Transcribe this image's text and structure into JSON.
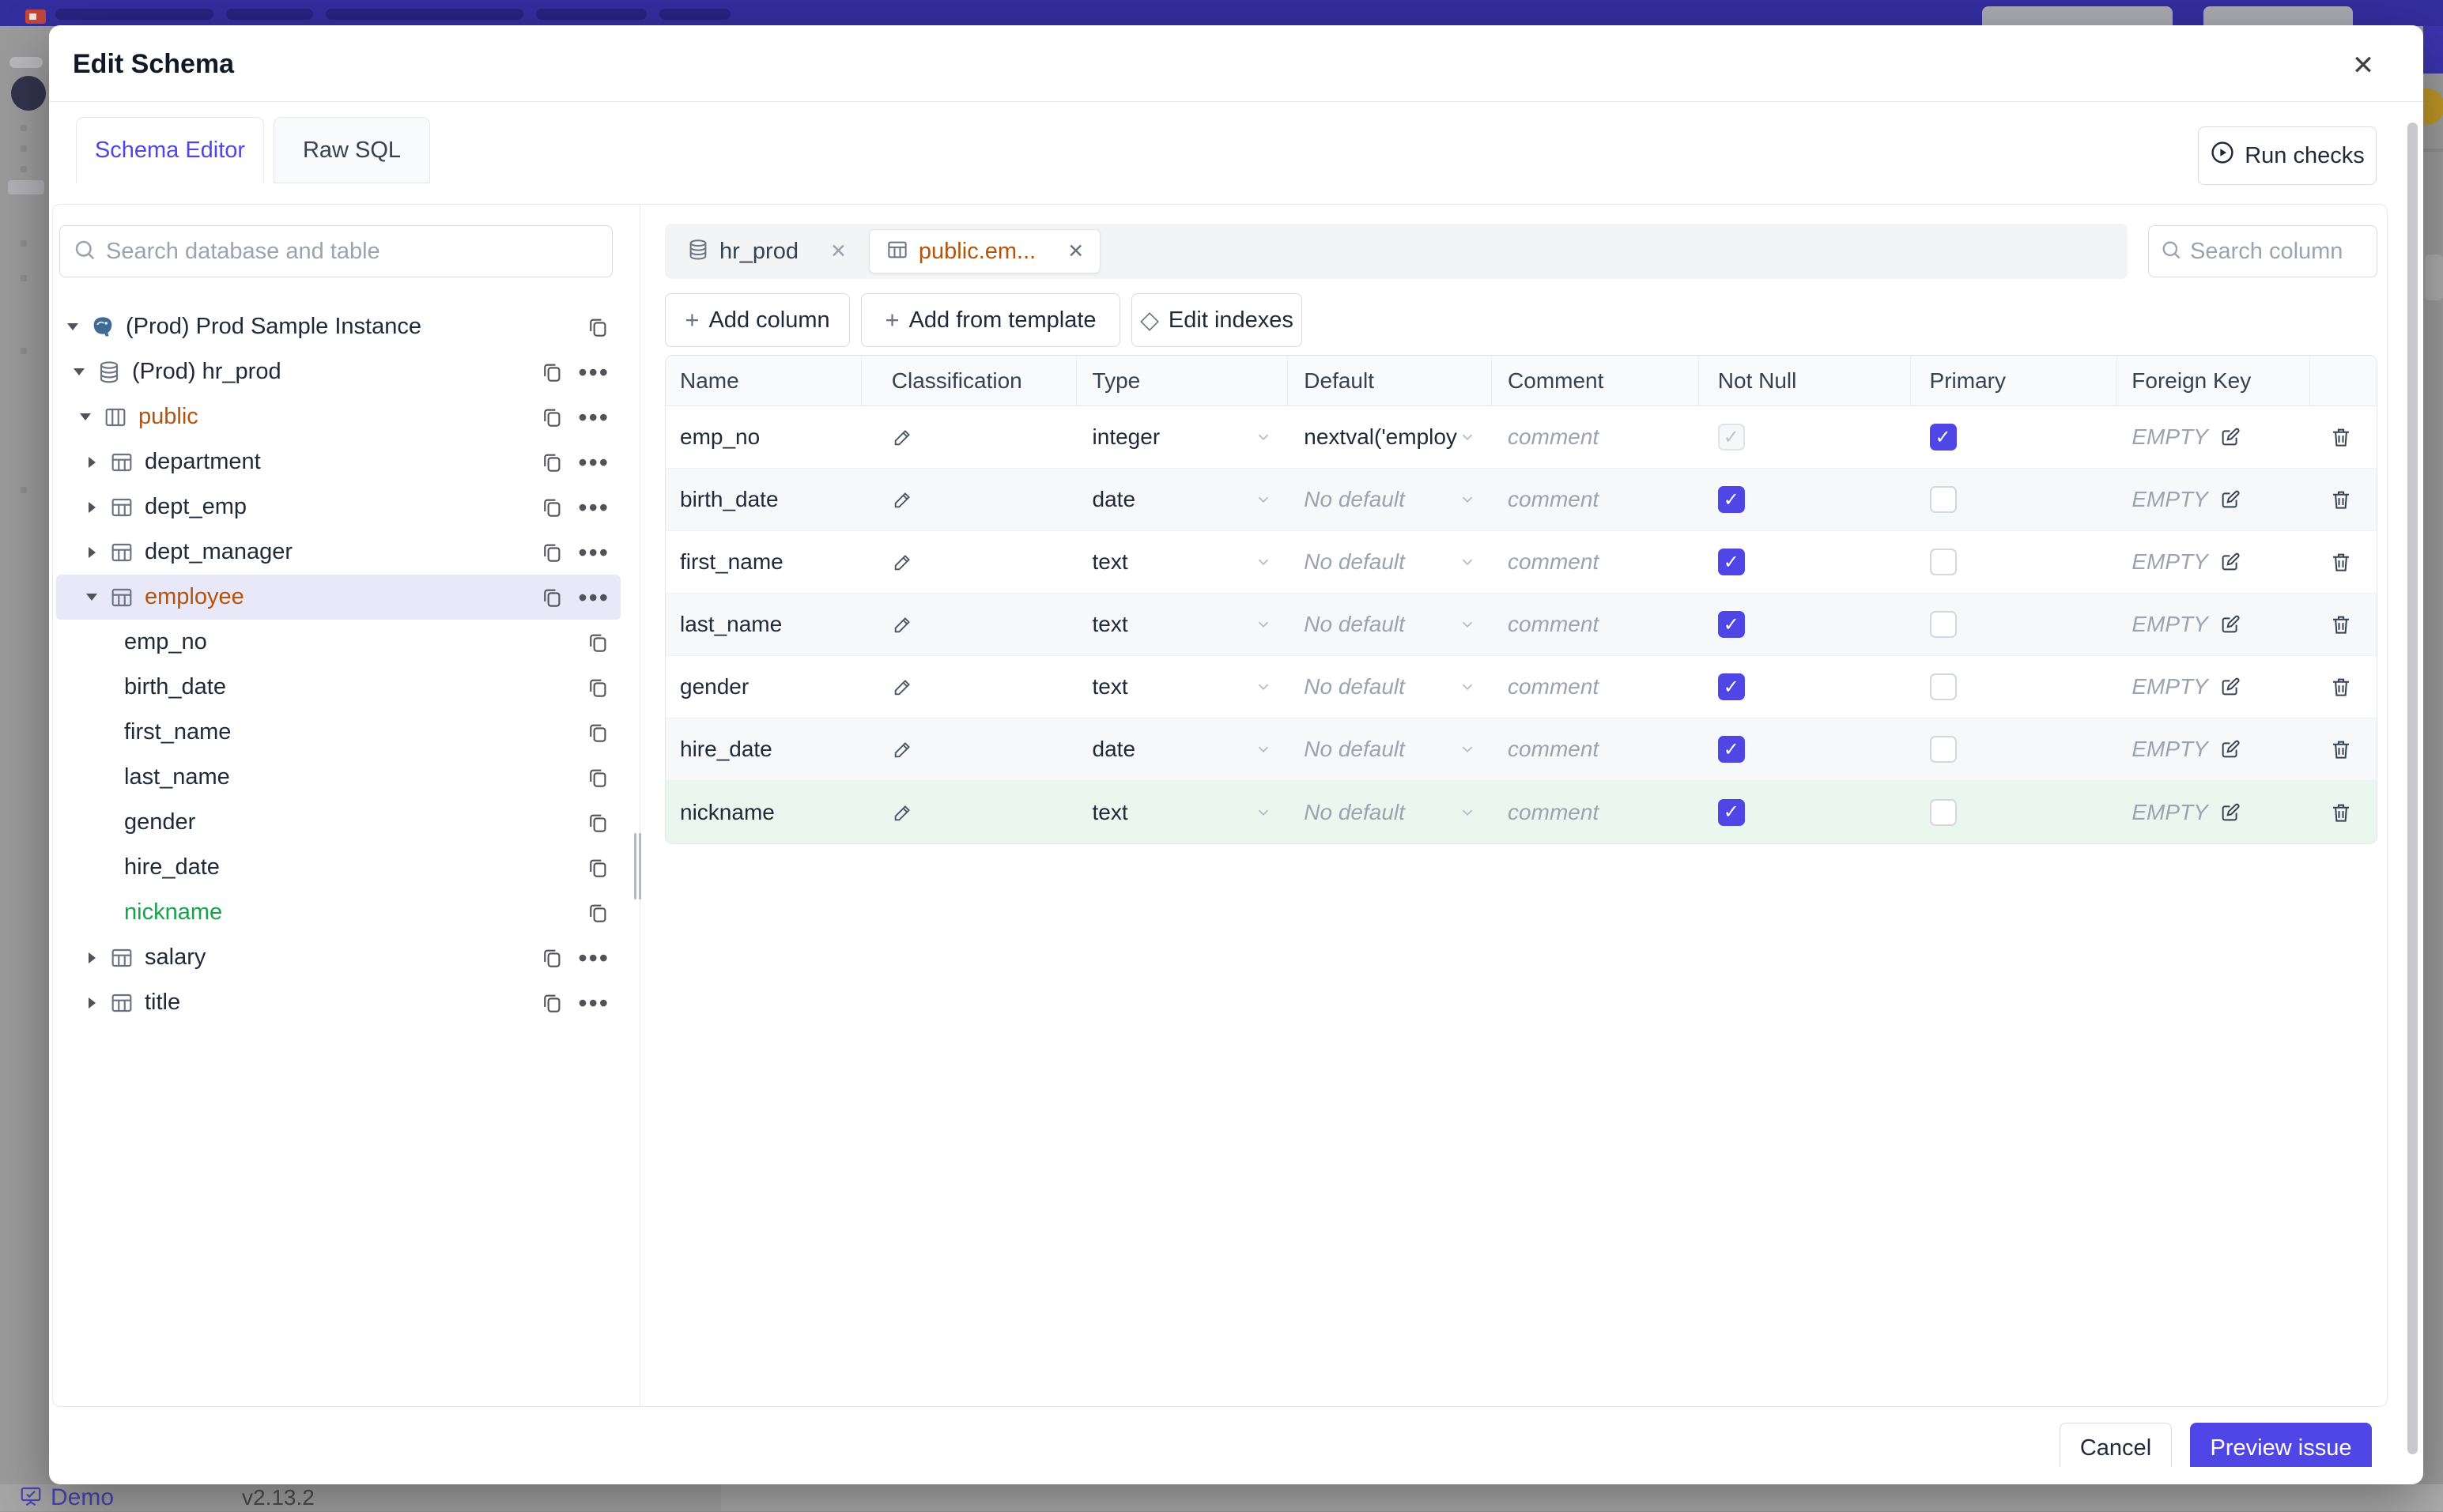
{
  "colors": {
    "accent": "#4f46e5",
    "modified_orange": "#b45309",
    "added_green": "#16a34a",
    "navbar": "#332e9e"
  },
  "chrome": {
    "demo_label": "Demo",
    "version": "v2.13.2"
  },
  "modal": {
    "title": "Edit Schema",
    "close_icon": "✕",
    "tabs": [
      {
        "label": "Schema Editor"
      },
      {
        "label": "Raw SQL"
      }
    ],
    "run_checks_label": "Run checks",
    "footer": {
      "cancel_label": "Cancel",
      "preview_label": "Preview issue"
    }
  },
  "sidebar": {
    "search_placeholder": "Search database and table",
    "tree": [
      {
        "label": "(Prod) Prod Sample Instance",
        "cls": "lvl0 caret-down ic-pg"
      },
      {
        "label": "(Prod) hr_prod",
        "cls": "lvl1 caret-down ic-db more"
      },
      {
        "label": "public",
        "cls": "lvl2 caret-down ic-schema modified more"
      },
      {
        "label": "department",
        "cls": "lvl3 caret-right ic-table copy more"
      },
      {
        "label": "dept_emp",
        "cls": "lvl3 caret-right ic-table copy more"
      },
      {
        "label": "dept_manager",
        "cls": "lvl3 caret-right ic-table copy more"
      },
      {
        "label": "employee",
        "cls": "lvl3 caret-down ic-table modified selected copy more"
      },
      {
        "label": "emp_no",
        "cls": "lvlcol"
      },
      {
        "label": "birth_date",
        "cls": "lvlcol"
      },
      {
        "label": "first_name",
        "cls": "lvlcol"
      },
      {
        "label": "last_name",
        "cls": "lvlcol"
      },
      {
        "label": "gender",
        "cls": "lvlcol"
      },
      {
        "label": "hire_date",
        "cls": "lvlcol"
      },
      {
        "label": "nickname",
        "cls": "lvlcol added"
      },
      {
        "label": "salary",
        "cls": "lvl3 caret-right ic-table copy more"
      },
      {
        "label": "title",
        "cls": "lvl3 caret-right ic-table copy more"
      }
    ]
  },
  "editor": {
    "open_tabs": [
      {
        "label": "hr_prod",
        "close_icon": "✕"
      },
      {
        "label": "public.em...",
        "close_icon": "✕"
      }
    ],
    "column_search_placeholder": "Search column",
    "actions": [
      {
        "icon": "+",
        "label": "Add column"
      },
      {
        "icon": "+",
        "label": "Add from template"
      },
      {
        "icon": "◇",
        "label": "Edit indexes"
      }
    ],
    "table": {
      "headers": [
        "Name",
        "Classification",
        "Type",
        "Default",
        "Comment",
        "Not Null",
        "Primary",
        "Foreign Key",
        ""
      ],
      "foreign_key_empty": "EMPTY",
      "rows": [
        {
          "name": "emp_no",
          "type": "integer",
          "default": "nextval('employ",
          "default_state": "value",
          "comment_placeholder": "comment",
          "not_null": "on disabled",
          "primary": "on",
          "foreign_key": "EMPTY",
          "state": ""
        },
        {
          "name": "birth_date",
          "type": "date",
          "default": "No default",
          "default_state": "placeholder",
          "comment_placeholder": "comment",
          "not_null": "on",
          "primary": "off",
          "foreign_key": "EMPTY",
          "state": ""
        },
        {
          "name": "first_name",
          "type": "text",
          "default": "No default",
          "default_state": "placeholder",
          "comment_placeholder": "comment",
          "not_null": "on",
          "primary": "off",
          "foreign_key": "EMPTY",
          "state": ""
        },
        {
          "name": "last_name",
          "type": "text",
          "default": "No default",
          "default_state": "placeholder",
          "comment_placeholder": "comment",
          "not_null": "on",
          "primary": "off",
          "foreign_key": "EMPTY",
          "state": ""
        },
        {
          "name": "gender",
          "type": "text",
          "default": "No default",
          "default_state": "placeholder",
          "comment_placeholder": "comment",
          "not_null": "on",
          "primary": "off",
          "foreign_key": "EMPTY",
          "state": ""
        },
        {
          "name": "hire_date",
          "type": "date",
          "default": "No default",
          "default_state": "placeholder",
          "comment_placeholder": "comment",
          "not_null": "on",
          "primary": "off",
          "foreign_key": "EMPTY",
          "state": ""
        },
        {
          "name": "nickname",
          "type": "text",
          "default": "No default",
          "default_state": "placeholder",
          "comment_placeholder": "comment",
          "not_null": "on",
          "primary": "off",
          "foreign_key": "EMPTY",
          "state": "added"
        }
      ]
    }
  }
}
